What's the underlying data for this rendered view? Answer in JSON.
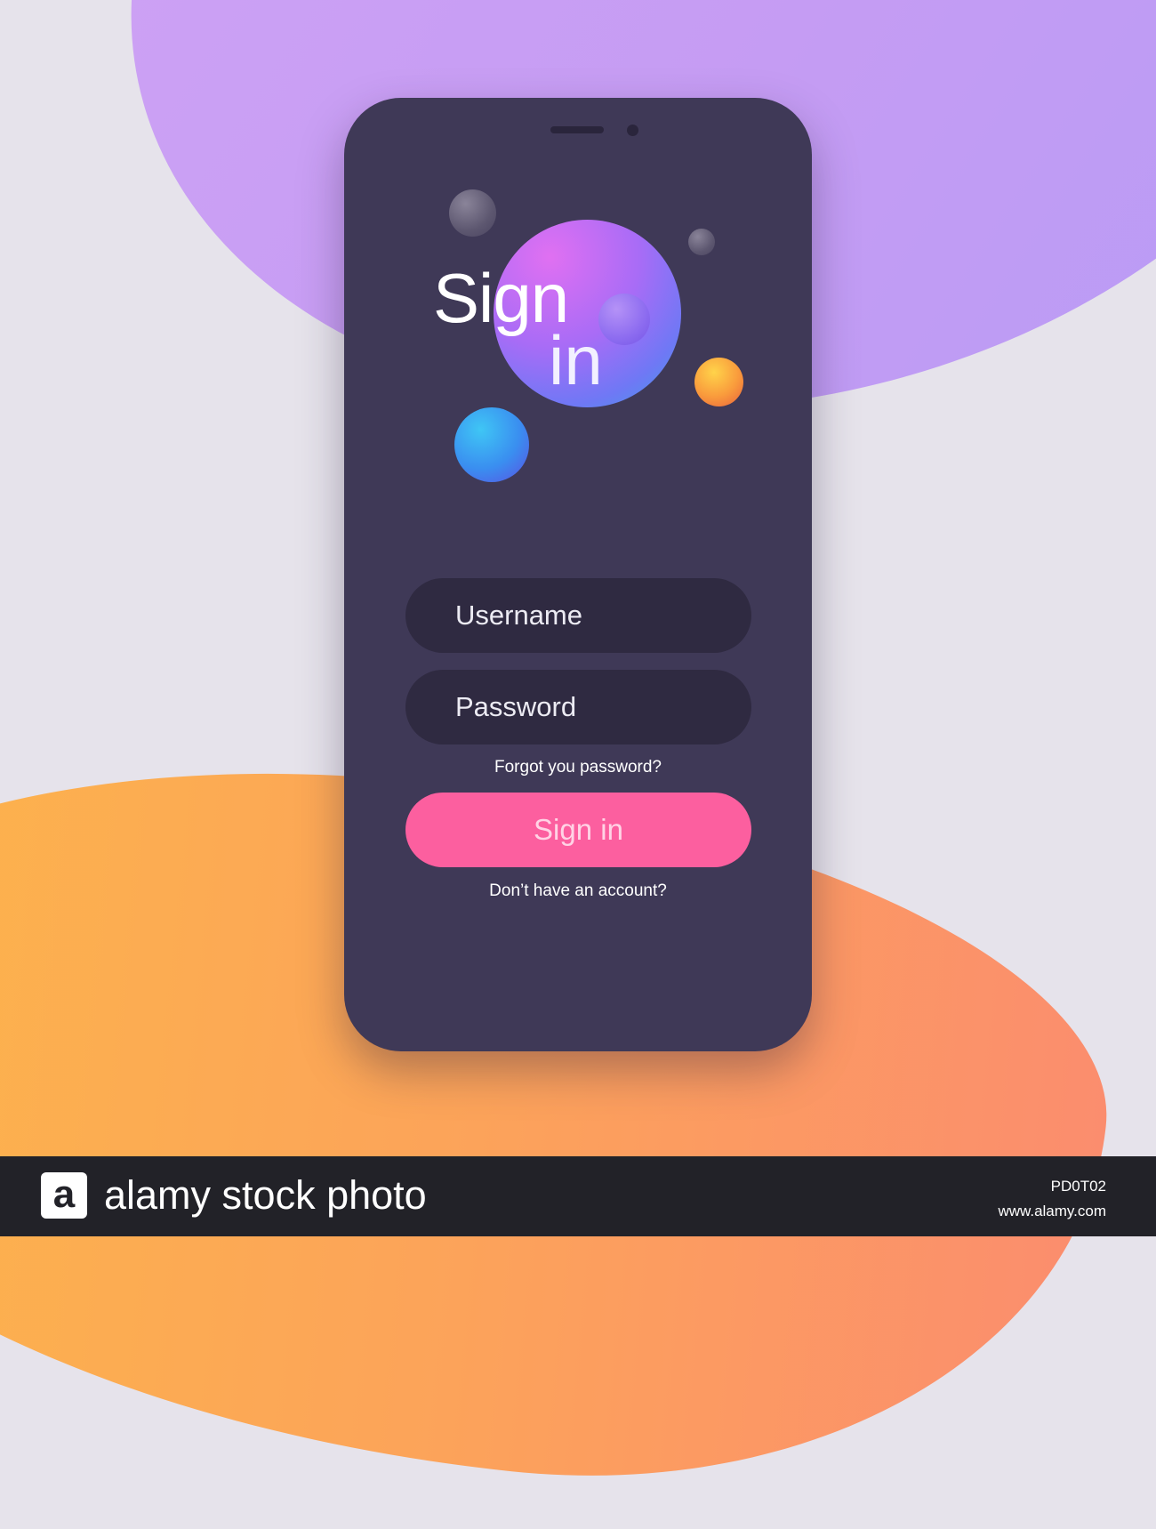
{
  "colors": {
    "background": "#e6e3eb",
    "phone_body": "#3f3957",
    "input_bg": "#2f2a41",
    "primary_button": "#fc5f9f",
    "blob_purple": "#c59cf3",
    "blob_orange": "#fdb748"
  },
  "screen": {
    "title_line1": "Sign",
    "title_line2": "in"
  },
  "form": {
    "username_placeholder": "Username",
    "password_placeholder": "Password",
    "forgot_link": "Forgot you password?",
    "signin_button": "Sign in",
    "signup_link": "Don’t have an account?"
  },
  "footer": {
    "logo_letter": "a",
    "brand_text": "alamy stock photo",
    "image_code": "PD0T02",
    "url": "www.alamy.com"
  }
}
